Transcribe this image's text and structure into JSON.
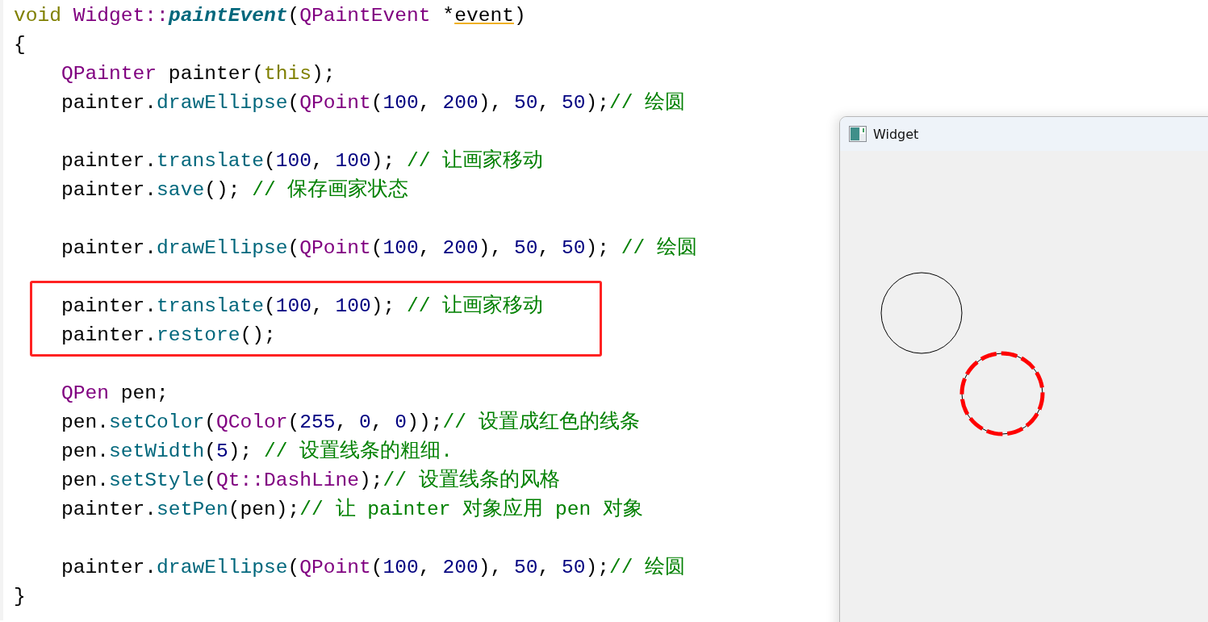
{
  "editor": {
    "lines": [
      {
        "kind": "code",
        "tokens": [
          {
            "text": "void ",
            "kind": "keyword"
          },
          {
            "text": "Widget::",
            "kind": "type"
          },
          {
            "text": "paintEvent",
            "kind": "declaration"
          },
          {
            "text": "(",
            "kind": "plain"
          },
          {
            "text": "QPaintEvent",
            "kind": "type"
          },
          {
            "text": " *",
            "kind": "plain"
          },
          {
            "text": "event",
            "kind": "warning"
          },
          {
            "text": ")",
            "kind": "plain"
          }
        ]
      },
      {
        "kind": "code",
        "tokens": [
          {
            "text": "{",
            "kind": "plain"
          }
        ]
      },
      {
        "kind": "code",
        "tokens": [
          {
            "text": "    QPainter",
            "kind": "type"
          },
          {
            "text": " painter(",
            "kind": "plain"
          },
          {
            "text": "this",
            "kind": "keyword"
          },
          {
            "text": ");",
            "kind": "plain"
          }
        ]
      },
      {
        "kind": "code",
        "tokens": [
          {
            "text": "    painter.",
            "kind": "plain"
          },
          {
            "text": "drawEllipse",
            "kind": "function"
          },
          {
            "text": "(",
            "kind": "plain"
          },
          {
            "text": "QPoint",
            "kind": "type"
          },
          {
            "text": "(",
            "kind": "plain"
          },
          {
            "text": "100",
            "kind": "number"
          },
          {
            "text": ", ",
            "kind": "plain"
          },
          {
            "text": "200",
            "kind": "number"
          },
          {
            "text": "), ",
            "kind": "plain"
          },
          {
            "text": "50",
            "kind": "number"
          },
          {
            "text": ", ",
            "kind": "plain"
          },
          {
            "text": "50",
            "kind": "number"
          },
          {
            "text": ");",
            "kind": "plain"
          },
          {
            "text": "// 绘圆",
            "kind": "comment"
          }
        ]
      },
      {
        "kind": "blank"
      },
      {
        "kind": "code",
        "tokens": [
          {
            "text": "    painter.",
            "kind": "plain"
          },
          {
            "text": "translate",
            "kind": "function"
          },
          {
            "text": "(",
            "kind": "plain"
          },
          {
            "text": "100",
            "kind": "number"
          },
          {
            "text": ", ",
            "kind": "plain"
          },
          {
            "text": "100",
            "kind": "number"
          },
          {
            "text": "); ",
            "kind": "plain"
          },
          {
            "text": "// 让画家移动",
            "kind": "comment"
          }
        ]
      },
      {
        "kind": "code",
        "tokens": [
          {
            "text": "    painter.",
            "kind": "plain"
          },
          {
            "text": "save",
            "kind": "function"
          },
          {
            "text": "(); ",
            "kind": "plain"
          },
          {
            "text": "// 保存画家状态",
            "kind": "comment"
          }
        ]
      },
      {
        "kind": "blank"
      },
      {
        "kind": "code",
        "tokens": [
          {
            "text": "    painter.",
            "kind": "plain"
          },
          {
            "text": "drawEllipse",
            "kind": "function"
          },
          {
            "text": "(",
            "kind": "plain"
          },
          {
            "text": "QPoint",
            "kind": "type"
          },
          {
            "text": "(",
            "kind": "plain"
          },
          {
            "text": "100",
            "kind": "number"
          },
          {
            "text": ", ",
            "kind": "plain"
          },
          {
            "text": "200",
            "kind": "number"
          },
          {
            "text": "), ",
            "kind": "plain"
          },
          {
            "text": "50",
            "kind": "number"
          },
          {
            "text": ", ",
            "kind": "plain"
          },
          {
            "text": "50",
            "kind": "number"
          },
          {
            "text": "); ",
            "kind": "plain"
          },
          {
            "text": "// 绘圆",
            "kind": "comment"
          }
        ]
      },
      {
        "kind": "blank"
      },
      {
        "kind": "boxed",
        "lines": [
          {
            "kind": "code",
            "tokens": [
              {
                "text": "    painter.",
                "kind": "plain"
              },
              {
                "text": "translate",
                "kind": "function"
              },
              {
                "text": "(",
                "kind": "plain"
              },
              {
                "text": "100",
                "kind": "number"
              },
              {
                "text": ", ",
                "kind": "plain"
              },
              {
                "text": "100",
                "kind": "number"
              },
              {
                "text": "); ",
                "kind": "plain"
              },
              {
                "text": "// 让画家移动",
                "kind": "comment"
              }
            ]
          },
          {
            "kind": "code",
            "tokens": [
              {
                "text": "    painter.",
                "kind": "plain"
              },
              {
                "text": "restore",
                "kind": "function"
              },
              {
                "text": "();",
                "kind": "plain"
              }
            ]
          }
        ]
      },
      {
        "kind": "blank"
      },
      {
        "kind": "code",
        "tokens": [
          {
            "text": "    QPen",
            "kind": "type"
          },
          {
            "text": " pen;",
            "kind": "plain"
          }
        ]
      },
      {
        "kind": "code",
        "tokens": [
          {
            "text": "    pen.",
            "kind": "plain"
          },
          {
            "text": "setColor",
            "kind": "function"
          },
          {
            "text": "(",
            "kind": "plain"
          },
          {
            "text": "QColor",
            "kind": "type"
          },
          {
            "text": "(",
            "kind": "plain"
          },
          {
            "text": "255",
            "kind": "number"
          },
          {
            "text": ", ",
            "kind": "plain"
          },
          {
            "text": "0",
            "kind": "number"
          },
          {
            "text": ", ",
            "kind": "plain"
          },
          {
            "text": "0",
            "kind": "number"
          },
          {
            "text": "));",
            "kind": "plain"
          },
          {
            "text": "// 设置成红色的线条",
            "kind": "comment"
          }
        ]
      },
      {
        "kind": "code",
        "tokens": [
          {
            "text": "    pen.",
            "kind": "plain"
          },
          {
            "text": "setWidth",
            "kind": "function"
          },
          {
            "text": "(",
            "kind": "plain"
          },
          {
            "text": "5",
            "kind": "number"
          },
          {
            "text": "); ",
            "kind": "plain"
          },
          {
            "text": "// 设置线条的粗细.",
            "kind": "comment"
          }
        ]
      },
      {
        "kind": "code",
        "tokens": [
          {
            "text": "    pen.",
            "kind": "plain"
          },
          {
            "text": "setStyle",
            "kind": "function"
          },
          {
            "text": "(",
            "kind": "plain"
          },
          {
            "text": "Qt::DashLine",
            "kind": "type"
          },
          {
            "text": ");",
            "kind": "plain"
          },
          {
            "text": "// 设置线条的风格",
            "kind": "comment"
          }
        ]
      },
      {
        "kind": "code",
        "tokens": [
          {
            "text": "    painter.",
            "kind": "plain"
          },
          {
            "text": "setPen",
            "kind": "function"
          },
          {
            "text": "(pen);",
            "kind": "plain"
          },
          {
            "text": "// 让 painter 对象应用 pen 对象",
            "kind": "comment"
          }
        ]
      },
      {
        "kind": "blank"
      },
      {
        "kind": "code",
        "tokens": [
          {
            "text": "    painter.",
            "kind": "plain"
          },
          {
            "text": "drawEllipse",
            "kind": "function"
          },
          {
            "text": "(",
            "kind": "plain"
          },
          {
            "text": "QPoint",
            "kind": "type"
          },
          {
            "text": "(",
            "kind": "plain"
          },
          {
            "text": "100",
            "kind": "number"
          },
          {
            "text": ", ",
            "kind": "plain"
          },
          {
            "text": "200",
            "kind": "number"
          },
          {
            "text": "), ",
            "kind": "plain"
          },
          {
            "text": "50",
            "kind": "number"
          },
          {
            "text": ", ",
            "kind": "plain"
          },
          {
            "text": "50",
            "kind": "number"
          },
          {
            "text": ");",
            "kind": "plain"
          },
          {
            "text": "// 绘圆",
            "kind": "comment"
          }
        ]
      },
      {
        "kind": "code",
        "tokens": [
          {
            "text": "}",
            "kind": "plain"
          }
        ]
      }
    ]
  },
  "window": {
    "title": "Widget"
  }
}
